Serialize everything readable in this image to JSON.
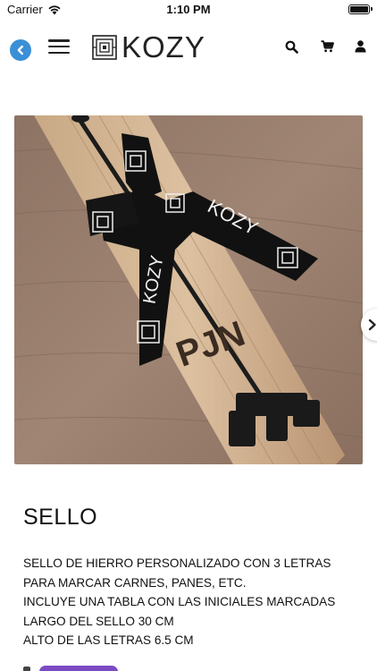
{
  "status_bar": {
    "carrier": "Carrier",
    "time": "1:10 PM"
  },
  "header": {
    "brand": "KOZY",
    "icons": [
      "back-icon",
      "menu-icon",
      "search-icon",
      "cart-icon",
      "user-icon"
    ],
    "back_color": "#3a8fd6"
  },
  "product": {
    "title": "SELLO",
    "image_ribbon_text": "KOZY",
    "image_letters": "PJN",
    "description": [
      "SELLO DE HIERRO PERSONALIZADO CON 3 LETRAS",
      "PARA MARCAR CARNES, PANES, ETC.",
      "INCLUYE UNA TABLA CON LAS INICIALES MARCADAS",
      "LARGO DEL SELLO 30 CM",
      "ALTO DE LAS LETRAS 6.5 CM"
    ]
  },
  "colors": {
    "accent_purple": "#7b4bc4",
    "ribbon": "#111111",
    "wood": "#b08a64"
  }
}
